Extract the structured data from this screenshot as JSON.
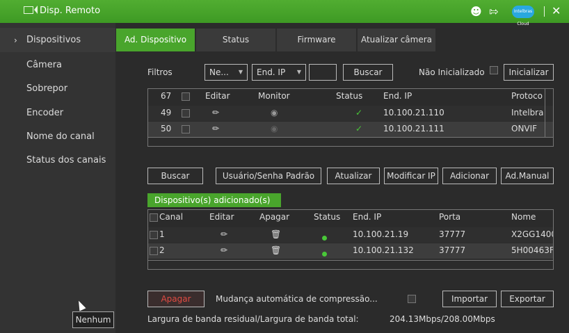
{
  "title": "Disp. Remoto",
  "icons": {
    "user": "user-gear-icon",
    "logout": "logout-icon",
    "cloud": "cloud-icon",
    "close": "close-icon"
  },
  "cloud_label": "Intelbras Cloud",
  "sidebar": {
    "items": [
      {
        "label": "Dispositivos"
      },
      {
        "label": "Câmera"
      },
      {
        "label": "Sobrepor"
      },
      {
        "label": "Encoder"
      },
      {
        "label": "Nome do canal"
      },
      {
        "label": "Status dos canais"
      }
    ],
    "tooltip": "Nenhum"
  },
  "tabs": [
    {
      "label": "Ad. Dispositivo"
    },
    {
      "label": "Status"
    },
    {
      "label": "Firmware"
    },
    {
      "label": "Atualizar câmera"
    }
  ],
  "filters": {
    "label": "Filtros",
    "select1": "Ne...",
    "select2": "End. IP",
    "search": "Buscar",
    "uninit_label": "Não Inicializado",
    "init_button": "Inicializar"
  },
  "search_table": {
    "headers": [
      "67",
      "Editar",
      "Monitor",
      "Status",
      "End. IP",
      "Protoco"
    ],
    "rows": [
      {
        "num": "49",
        "ip": "10.100.21.110",
        "protocol": "Intelbra"
      },
      {
        "num": "50",
        "ip": "10.100.21.111",
        "protocol": "ONVIF"
      }
    ]
  },
  "actions": [
    "Buscar",
    "Usuário/Senha Padrão",
    "Atualizar",
    "Modificar IP",
    "Adicionar",
    "Ad.Manual"
  ],
  "added_label": "Dispositivo(s) adicionado(s)",
  "added_table": {
    "headers": [
      "Canal",
      "Editar",
      "Apagar",
      "Status",
      "End. IP",
      "Porta",
      "Nome"
    ],
    "rows": [
      {
        "channel": "1",
        "ip": "10.100.21.19",
        "port": "37777",
        "name": "X2GG1400"
      },
      {
        "channel": "2",
        "ip": "10.100.21.132",
        "port": "37777",
        "name": "5H00463F"
      }
    ]
  },
  "bottom": {
    "delete": "Apagar",
    "compression": "Mudança automática de compressão...",
    "import": "Importar",
    "export": "Exportar",
    "bandwidth_label": "Largura de banda residual/Largura de banda total:",
    "bandwidth_value": "204.13Mbps/208.00Mbps"
  },
  "colors": {
    "accent": "#49a52c",
    "status_ok": "#49c838",
    "delete": "#e04b43"
  }
}
